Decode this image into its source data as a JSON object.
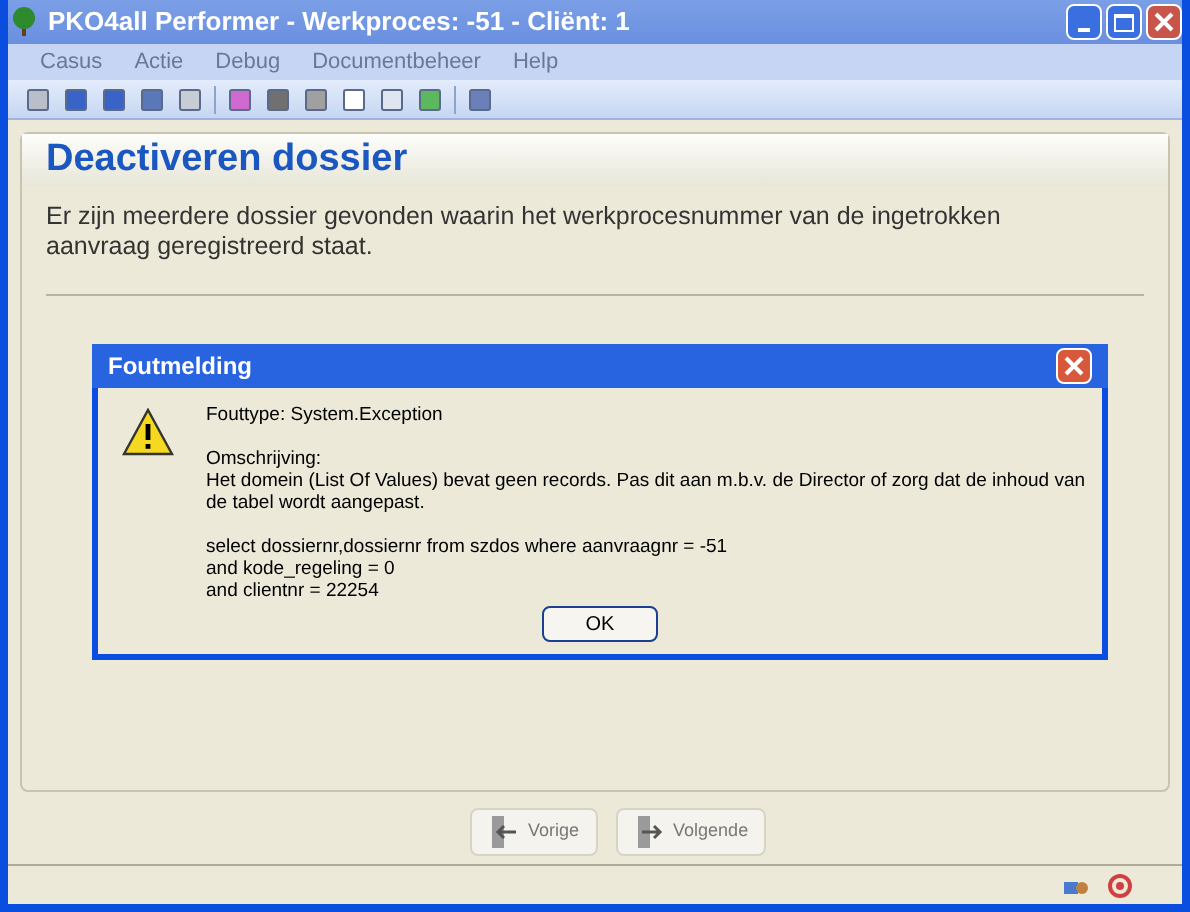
{
  "window": {
    "title": "PKO4all Performer - Werkproces: -51 - Cliënt: 1"
  },
  "menu": [
    {
      "label": "Casus",
      "disabled": true
    },
    {
      "label": "Actie",
      "disabled": true
    },
    {
      "label": "Debug",
      "disabled": true
    },
    {
      "label": "Documentbeheer",
      "disabled": true
    },
    {
      "label": "Help",
      "disabled": true
    }
  ],
  "page": {
    "heading": "Deactiveren dossier",
    "message": "Er zijn meerdere dossier gevonden waarin het werkprocesnummer van de ingetrokken aanvraag geregistreerd staat."
  },
  "dialog": {
    "title": "Foutmelding",
    "type_line": "Fouttype: System.Exception",
    "description_label": "Omschrijving:",
    "description": "Het domein (List Of Values) bevat geen records. Pas dit aan m.b.v. de Director of zorg dat de inhoud van de tabel wordt aangepast.",
    "query_lines": [
      "select dossiernr,dossiernr from szdos where aanvraagnr = -51",
      "and kode_regeling = 0",
      "and clientnr = 22254"
    ],
    "ok_button": "OK"
  },
  "nav_buttons": [
    {
      "label": "Vorige",
      "disabled": true
    },
    {
      "label": "Volgende",
      "disabled": true
    }
  ]
}
